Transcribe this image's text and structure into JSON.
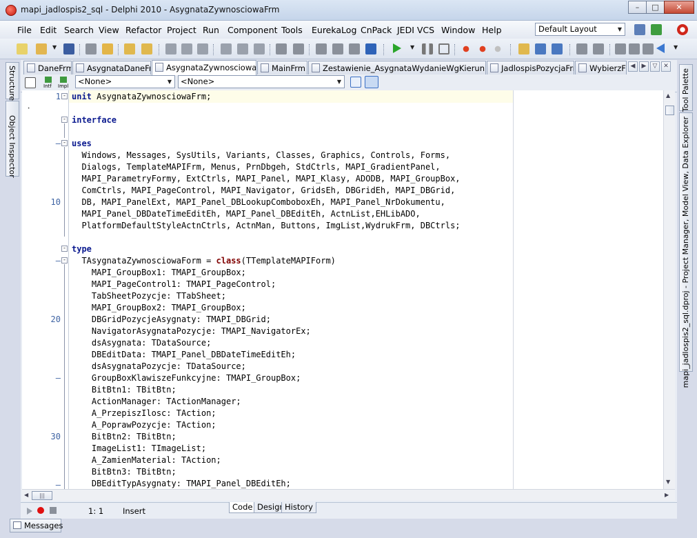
{
  "window": {
    "title": "mapi_jadlospis2_sql - Delphi 2010 - AsygnataZywnosciowaFrm"
  },
  "menu": [
    "File",
    "Edit",
    "Search",
    "View",
    "Refactor",
    "Project",
    "Run",
    "Component",
    "Tools",
    "EurekaLog",
    "CnPack",
    "JEDI VCS",
    "Window",
    "Help"
  ],
  "layout": {
    "selected": "Default Layout"
  },
  "left_panels": [
    "Structure",
    "Object Inspector"
  ],
  "right_panels": [
    "Tool Palette",
    "mapi_jadlospis2_sql.dproj - Project Manager, Model View, Data Explorer"
  ],
  "tabs": [
    "DaneFrm",
    "AsygnataDaneFrm",
    "AsygnataZywnosciowaFrm",
    "MainFrm",
    "Zestawienie_AsygnataWydanieWgKierunkowFrm",
    "JadlospisPozycjaFrm",
    "WybierzFrm"
  ],
  "active_tab": "AsygnataZywnosciowaFrm",
  "selectors": {
    "left": "<None>",
    "right": "<None>",
    "intf": "Intf",
    "impl": "Impl"
  },
  "line_numbers": {
    "l1": "1",
    "l10": "10",
    "l20": "20",
    "l30": "30"
  },
  "code": [
    "unit AsygnataZywnosciowaFrm;",
    "",
    "interface",
    "",
    "uses",
    "  Windows, Messages, SysUtils, Variants, Classes, Graphics, Controls, Forms,",
    "  Dialogs, TemplateMAPIFrm, Menus, PrnDbgeh, StdCtrls, MAPI_GradientPanel,",
    "  MAPI_ParametryFormy, ExtCtrls, MAPI_Panel, MAPI_Klasy, ADODB, MAPI_GroupBox,",
    "  ComCtrls, MAPI_PageControl, MAPI_Navigator, GridsEh, DBGridEh, MAPI_DBGrid,",
    "  DB, MAPI_PanelExt, MAPI_Panel_DBLookupComboboxEh, MAPI_Panel_NrDokumentu,",
    "  MAPI_Panel_DBDateTimeEditEh, MAPI_Panel_DBEditEh, ActnList,EHLibADO,",
    "  PlatformDefaultStyleActnCtrls, ActnMan, Buttons, ImgList,WydrukFrm, DBCtrls;",
    "",
    "type",
    "  TAsygnataZywnosciowaForm = class(TTemplateMAPIForm)",
    "    MAPI_GroupBox1: TMAPI_GroupBox;",
    "    MAPI_PageControl1: TMAPI_PageControl;",
    "    TabSheetPozycje: TTabSheet;",
    "    MAPI_GroupBox2: TMAPI_GroupBox;",
    "    DBGridPozycjeAsygnaty: TMAPI_DBGrid;",
    "    NavigatorAsygnataPozycje: TMAPI_NavigatorEx;",
    "    dsAsygnata: TDataSource;",
    "    DBEditData: TMAPI_Panel_DBDateTimeEditEh;",
    "    dsAsygnataPozycje: TDataSource;",
    "    GroupBoxKlawiszeFunkcyjne: TMAPI_GroupBox;",
    "    BitBtn1: TBitBtn;",
    "    ActionManager: TActionManager;",
    "    A_PrzepiszIlosc: TAction;",
    "    A_PoprawPozycje: TAction;",
    "    BitBtn2: TBitBtn;",
    "    ImageList1: TImageList;",
    "    A_ZamienMaterial: TAction;",
    "    BitBtn3: TBitBtn;",
    "    DBEditTypAsygnaty: TMAPI_Panel_DBEditEh;"
  ],
  "status": {
    "position": "1:  1",
    "mode": "Insert"
  },
  "bottom_tabs": [
    "Code",
    "Design",
    "History"
  ],
  "messages": "Messages"
}
